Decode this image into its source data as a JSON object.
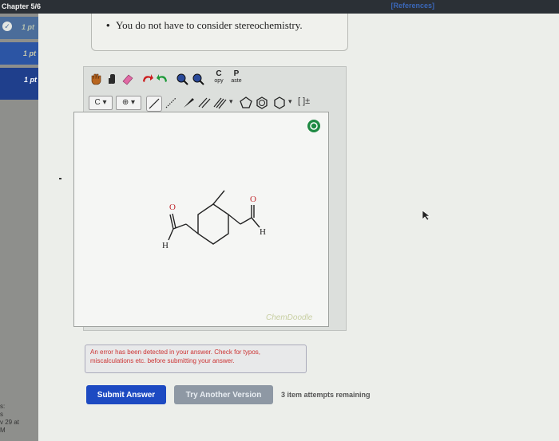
{
  "header": {
    "chapter": "Chapter 5/6",
    "references": "[References]"
  },
  "sidebar": {
    "items": [
      {
        "points": "1 pt",
        "completed": true
      },
      {
        "points": "1 pt",
        "completed": false
      },
      {
        "points": "1 pt",
        "completed": false,
        "current": true
      }
    ],
    "footer_lines": [
      "s:",
      "s",
      "v 29 at",
      "M"
    ]
  },
  "question": {
    "note": "You do not have to consider stereochemistry."
  },
  "editor": {
    "copy_label_top": "C",
    "copy_label_bottom": "opy",
    "paste_label_top": "P",
    "paste_label_bottom": "aste",
    "element_dropdown": "C",
    "charge_symbol": "⊕",
    "bracket_symbol": "[ ]±",
    "watermark": "ChemDoodle",
    "molecule_labels": {
      "o_left": "O",
      "o_right": "O",
      "h_left": "H",
      "h_right": "H"
    }
  },
  "feedback": {
    "error_message": "An error has been detected in your answer. Check for typos, miscalculations etc. before submitting your answer."
  },
  "actions": {
    "submit_label": "Submit Answer",
    "try_another_label": "Try Another Version",
    "attempts_remaining": "3 item attempts remaining"
  },
  "colors": {
    "submit": "#1d4ac2",
    "sidebar_active": "#1f3f8c",
    "canvas": "#f5f6f4"
  }
}
